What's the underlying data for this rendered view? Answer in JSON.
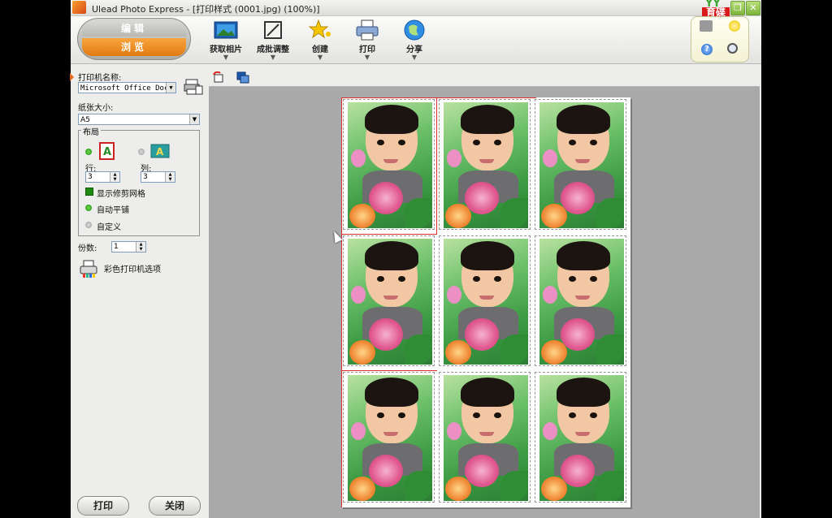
{
  "window": {
    "title": "Ulead Photo Express - [打印样式 (0001.jpg)  (100%)]",
    "logo_top": "YY",
    "logo_text": "育碟\n软件",
    "btn_minimize": "_",
    "btn_restore": "❐",
    "btn_close": "✕"
  },
  "toolbar": {
    "mode_edit": "编辑",
    "mode_browse": "浏览",
    "buttons": [
      {
        "label": "获取相片"
      },
      {
        "label": "成批调整"
      },
      {
        "label": "创建"
      },
      {
        "label": "打印"
      },
      {
        "label": "分享"
      }
    ],
    "arrow": "▼"
  },
  "left_panel": {
    "printer_label": "打印机名称:",
    "printer_value": "Microsoft Office Docu",
    "paper_label": "纸张大小:",
    "paper_value": "A5",
    "layout_group": "布局",
    "rows_label": "行:",
    "rows_value": "3",
    "cols_label": "列:",
    "cols_value": "3",
    "show_crop_grid": "显示修剪网格",
    "auto_tile": "自动平铺",
    "custom": "自定义",
    "copies_label": "份数:",
    "copies_value": "1",
    "color_printer_options": "彩色打印机选项",
    "print_button": "打印",
    "close_button": "关闭",
    "dropdown_arrow": "▼",
    "spin_up": "▲",
    "spin_down": "▼"
  },
  "preview": {
    "grid_rows": 3,
    "grid_cols": 3
  },
  "colors": {
    "accent_orange": "#e07a12",
    "checked_green": "#1e8a12",
    "preview_bg": "#a9a9a9"
  }
}
